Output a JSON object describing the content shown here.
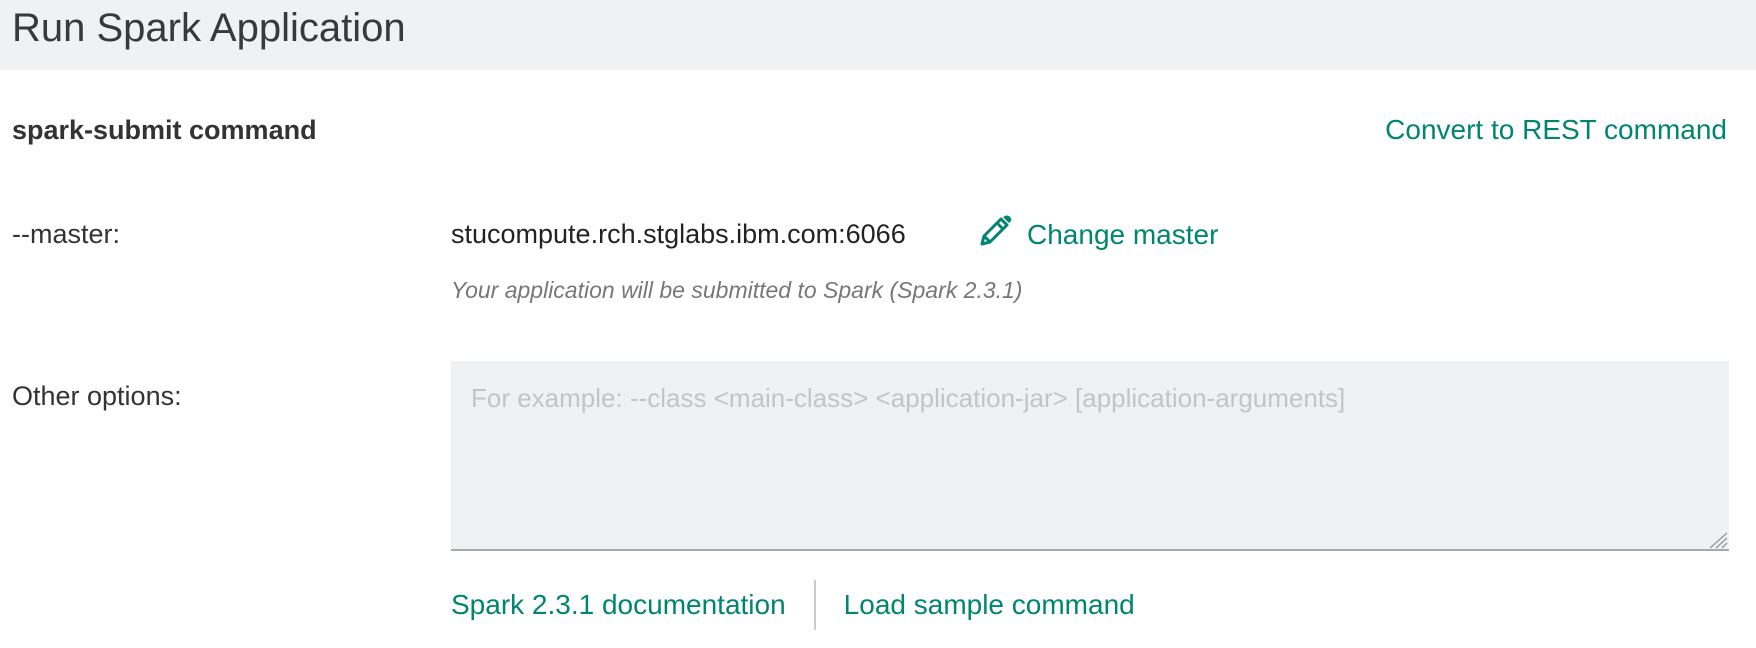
{
  "header": {
    "title": "Run Spark Application"
  },
  "section": {
    "title": "spark-submit command",
    "convert_link": "Convert to REST command"
  },
  "master": {
    "label": "--master:",
    "value": "stucompute.rch.stglabs.ibm.com:6066",
    "change_label": "Change master",
    "hint": "Your application will be submitted to Spark (Spark 2.3.1)"
  },
  "options": {
    "label": "Other options:",
    "placeholder": "For example: --class <main-class> <application-jar> [application-arguments]",
    "value": ""
  },
  "footer": {
    "docs_link": "Spark 2.3.1 documentation",
    "sample_link": "Load sample command"
  },
  "colors": {
    "accent": "#008571",
    "header_bg": "#f0f1f2",
    "text": "#333333",
    "hint": "#777777"
  },
  "icons": {
    "edit": "pencil-icon",
    "resize": "resize-handle-icon"
  }
}
